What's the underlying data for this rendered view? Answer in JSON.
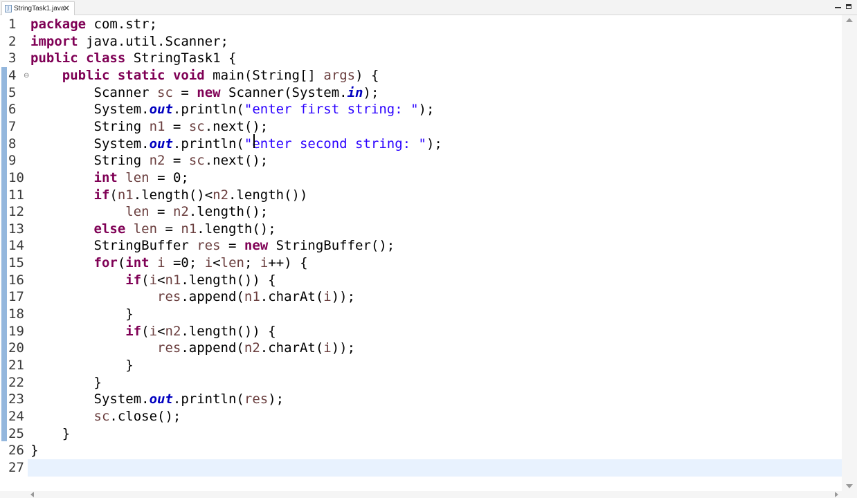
{
  "tab": {
    "filename": "StringTask1.java",
    "icon": "java-file-icon",
    "close_glyph": "✕"
  },
  "colors": {
    "keyword": "#7f0055",
    "string": "#2a00ff",
    "field": "#0000c0",
    "variable": "#6a3e3e",
    "current_line": "#e8f2fe",
    "ruler": "#94b7dd"
  },
  "editor": {
    "current_line_number": "27",
    "lines": [
      {
        "n": "1",
        "fold": "",
        "tokens": [
          {
            "t": "package",
            "c": "kw"
          },
          {
            "t": " com.str;",
            "c": ""
          }
        ]
      },
      {
        "n": "2",
        "fold": "",
        "tokens": [
          {
            "t": "import",
            "c": "kw"
          },
          {
            "t": " java.util.Scanner;",
            "c": ""
          }
        ]
      },
      {
        "n": "3",
        "fold": "",
        "tokens": [
          {
            "t": "public",
            "c": "kw"
          },
          {
            "t": " ",
            "c": ""
          },
          {
            "t": "class",
            "c": "kw"
          },
          {
            "t": " StringTask1 {",
            "c": ""
          }
        ]
      },
      {
        "n": "4",
        "fold": "⊖",
        "tokens": [
          {
            "t": "    ",
            "c": ""
          },
          {
            "t": "public",
            "c": "kw"
          },
          {
            "t": " ",
            "c": ""
          },
          {
            "t": "static",
            "c": "kw"
          },
          {
            "t": " ",
            "c": ""
          },
          {
            "t": "void",
            "c": "kw"
          },
          {
            "t": " main(String[] ",
            "c": ""
          },
          {
            "t": "args",
            "c": "var"
          },
          {
            "t": ") {",
            "c": ""
          }
        ]
      },
      {
        "n": "5",
        "fold": "",
        "tokens": [
          {
            "t": "        Scanner ",
            "c": ""
          },
          {
            "t": "sc",
            "c": "var"
          },
          {
            "t": " = ",
            "c": ""
          },
          {
            "t": "new",
            "c": "kw"
          },
          {
            "t": " Scanner(System.",
            "c": ""
          },
          {
            "t": "in",
            "c": "fld"
          },
          {
            "t": ");",
            "c": ""
          }
        ]
      },
      {
        "n": "6",
        "fold": "",
        "tokens": [
          {
            "t": "        System.",
            "c": ""
          },
          {
            "t": "out",
            "c": "fld"
          },
          {
            "t": ".println(",
            "c": ""
          },
          {
            "t": "\"enter first string: \"",
            "c": "str"
          },
          {
            "t": ");",
            "c": ""
          }
        ]
      },
      {
        "n": "7",
        "fold": "",
        "tokens": [
          {
            "t": "        String ",
            "c": ""
          },
          {
            "t": "n1",
            "c": "var"
          },
          {
            "t": " = ",
            "c": ""
          },
          {
            "t": "sc",
            "c": "var"
          },
          {
            "t": ".next();",
            "c": ""
          }
        ]
      },
      {
        "n": "8",
        "fold": "",
        "tokens": [
          {
            "t": "        System.",
            "c": ""
          },
          {
            "t": "out",
            "c": "fld"
          },
          {
            "t": ".println(",
            "c": ""
          },
          {
            "t": "\"enter second string: \"",
            "c": "str"
          },
          {
            "t": ");",
            "c": ""
          }
        ]
      },
      {
        "n": "9",
        "fold": "",
        "tokens": [
          {
            "t": "        String ",
            "c": ""
          },
          {
            "t": "n2",
            "c": "var"
          },
          {
            "t": " = ",
            "c": ""
          },
          {
            "t": "sc",
            "c": "var"
          },
          {
            "t": ".next();",
            "c": ""
          }
        ]
      },
      {
        "n": "10",
        "fold": "",
        "tokens": [
          {
            "t": "        ",
            "c": ""
          },
          {
            "t": "int",
            "c": "kw"
          },
          {
            "t": " ",
            "c": ""
          },
          {
            "t": "len",
            "c": "var"
          },
          {
            "t": " = 0;",
            "c": ""
          }
        ]
      },
      {
        "n": "11",
        "fold": "",
        "tokens": [
          {
            "t": "        ",
            "c": ""
          },
          {
            "t": "if",
            "c": "kw"
          },
          {
            "t": "(",
            "c": ""
          },
          {
            "t": "n1",
            "c": "var"
          },
          {
            "t": ".length()<",
            "c": ""
          },
          {
            "t": "n2",
            "c": "var"
          },
          {
            "t": ".length())",
            "c": ""
          }
        ]
      },
      {
        "n": "12",
        "fold": "",
        "tokens": [
          {
            "t": "            ",
            "c": ""
          },
          {
            "t": "len",
            "c": "var"
          },
          {
            "t": " = ",
            "c": ""
          },
          {
            "t": "n2",
            "c": "var"
          },
          {
            "t": ".length();",
            "c": ""
          }
        ]
      },
      {
        "n": "13",
        "fold": "",
        "tokens": [
          {
            "t": "        ",
            "c": ""
          },
          {
            "t": "else",
            "c": "kw"
          },
          {
            "t": " ",
            "c": ""
          },
          {
            "t": "len",
            "c": "var"
          },
          {
            "t": " = ",
            "c": ""
          },
          {
            "t": "n1",
            "c": "var"
          },
          {
            "t": ".length();",
            "c": ""
          }
        ]
      },
      {
        "n": "14",
        "fold": "",
        "tokens": [
          {
            "t": "        StringBuffer ",
            "c": ""
          },
          {
            "t": "res",
            "c": "var"
          },
          {
            "t": " = ",
            "c": ""
          },
          {
            "t": "new",
            "c": "kw"
          },
          {
            "t": " StringBuffer();",
            "c": ""
          }
        ]
      },
      {
        "n": "15",
        "fold": "",
        "tokens": [
          {
            "t": "        ",
            "c": ""
          },
          {
            "t": "for",
            "c": "kw"
          },
          {
            "t": "(",
            "c": ""
          },
          {
            "t": "int",
            "c": "kw"
          },
          {
            "t": " ",
            "c": ""
          },
          {
            "t": "i",
            "c": "var"
          },
          {
            "t": " =0; ",
            "c": ""
          },
          {
            "t": "i",
            "c": "var"
          },
          {
            "t": "<",
            "c": ""
          },
          {
            "t": "len",
            "c": "var"
          },
          {
            "t": "; ",
            "c": ""
          },
          {
            "t": "i",
            "c": "var"
          },
          {
            "t": "++) {",
            "c": ""
          }
        ]
      },
      {
        "n": "16",
        "fold": "",
        "tokens": [
          {
            "t": "            ",
            "c": ""
          },
          {
            "t": "if",
            "c": "kw"
          },
          {
            "t": "(",
            "c": ""
          },
          {
            "t": "i",
            "c": "var"
          },
          {
            "t": "<",
            "c": ""
          },
          {
            "t": "n1",
            "c": "var"
          },
          {
            "t": ".length()) {",
            "c": ""
          }
        ]
      },
      {
        "n": "17",
        "fold": "",
        "tokens": [
          {
            "t": "                ",
            "c": ""
          },
          {
            "t": "res",
            "c": "var"
          },
          {
            "t": ".append(",
            "c": ""
          },
          {
            "t": "n1",
            "c": "var"
          },
          {
            "t": ".charAt(",
            "c": ""
          },
          {
            "t": "i",
            "c": "var"
          },
          {
            "t": "));",
            "c": ""
          }
        ]
      },
      {
        "n": "18",
        "fold": "",
        "tokens": [
          {
            "t": "            }",
            "c": ""
          }
        ]
      },
      {
        "n": "19",
        "fold": "",
        "tokens": [
          {
            "t": "            ",
            "c": ""
          },
          {
            "t": "if",
            "c": "kw"
          },
          {
            "t": "(",
            "c": ""
          },
          {
            "t": "i",
            "c": "var"
          },
          {
            "t": "<",
            "c": ""
          },
          {
            "t": "n2",
            "c": "var"
          },
          {
            "t": ".length()) {",
            "c": ""
          }
        ]
      },
      {
        "n": "20",
        "fold": "",
        "tokens": [
          {
            "t": "                ",
            "c": ""
          },
          {
            "t": "res",
            "c": "var"
          },
          {
            "t": ".append(",
            "c": ""
          },
          {
            "t": "n2",
            "c": "var"
          },
          {
            "t": ".charAt(",
            "c": ""
          },
          {
            "t": "i",
            "c": "var"
          },
          {
            "t": "));",
            "c": ""
          }
        ]
      },
      {
        "n": "21",
        "fold": "",
        "tokens": [
          {
            "t": "            }",
            "c": ""
          }
        ]
      },
      {
        "n": "22",
        "fold": "",
        "tokens": [
          {
            "t": "        }",
            "c": ""
          }
        ]
      },
      {
        "n": "23",
        "fold": "",
        "tokens": [
          {
            "t": "        System.",
            "c": ""
          },
          {
            "t": "out",
            "c": "fld"
          },
          {
            "t": ".println(",
            "c": ""
          },
          {
            "t": "res",
            "c": "var"
          },
          {
            "t": ");",
            "c": ""
          }
        ]
      },
      {
        "n": "24",
        "fold": "",
        "tokens": [
          {
            "t": "        ",
            "c": ""
          },
          {
            "t": "sc",
            "c": "var"
          },
          {
            "t": ".close();",
            "c": ""
          }
        ]
      },
      {
        "n": "25",
        "fold": "",
        "tokens": [
          {
            "t": "    }",
            "c": ""
          }
        ]
      },
      {
        "n": "26",
        "fold": "",
        "tokens": [
          {
            "t": "}",
            "c": ""
          }
        ]
      },
      {
        "n": "27",
        "fold": "",
        "tokens": []
      }
    ]
  }
}
